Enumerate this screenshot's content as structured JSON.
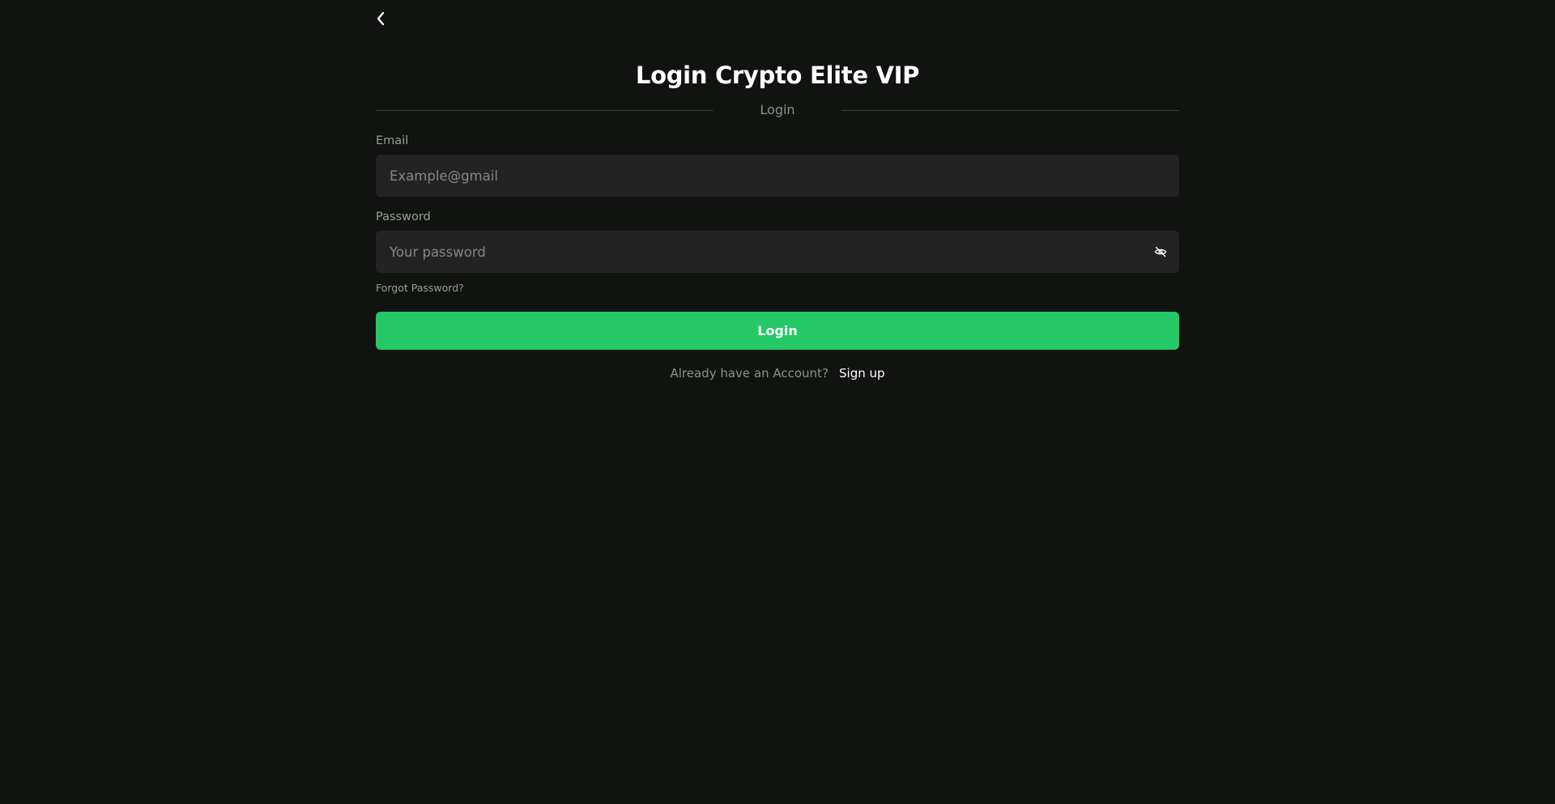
{
  "header": {
    "back_icon": "chevron-left-icon",
    "title": "Login Crypto Elite VIP"
  },
  "divider": {
    "label": "Login"
  },
  "form": {
    "email": {
      "label": "Email",
      "value": "",
      "placeholder": "Example@gmail"
    },
    "password": {
      "label": "Password",
      "value": "",
      "placeholder": "Your password",
      "toggle_icon": "eye-off-icon"
    },
    "forgot_password_label": "Forgot Password?",
    "submit_label": "Login"
  },
  "footer": {
    "prompt": "Already have an Account?",
    "signup_label": "Sign up"
  },
  "colors": {
    "background": "#111310",
    "input_background": "#232323",
    "accent": "#25c866",
    "muted_text": "#8d8f8c"
  }
}
